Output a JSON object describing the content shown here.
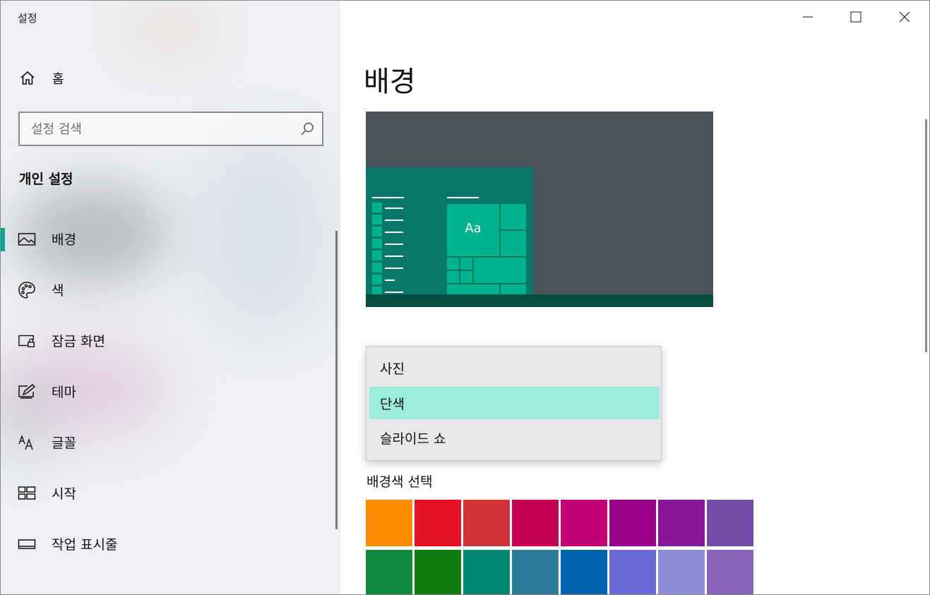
{
  "window": {
    "title": "설정"
  },
  "sidebar": {
    "home_label": "홈",
    "search_placeholder": "설정 검색",
    "section_title": "개인 설정",
    "items": [
      {
        "label": "배경",
        "icon": "picture-icon",
        "selected": true
      },
      {
        "label": "색",
        "icon": "palette-icon",
        "selected": false
      },
      {
        "label": "잠금 화면",
        "icon": "lock-screen-icon",
        "selected": false
      },
      {
        "label": "테마",
        "icon": "theme-brush-icon",
        "selected": false
      },
      {
        "label": "글꼴",
        "icon": "font-icon",
        "selected": false
      },
      {
        "label": "시작",
        "icon": "start-tiles-icon",
        "selected": false
      },
      {
        "label": "작업 표시줄",
        "icon": "taskbar-icon",
        "selected": false
      }
    ]
  },
  "main": {
    "page_title": "배경",
    "preview": {
      "tile_text": "Aa",
      "colors": {
        "desktop": "#4b535c",
        "start": "#0a7868",
        "tile": "#00b38f",
        "taskbar": "#064e42"
      }
    },
    "background_dropdown": {
      "options": [
        "사진",
        "단색",
        "슬라이드 쇼"
      ],
      "selected": "단색"
    },
    "bg_color_label": "배경색 선택",
    "swatches": [
      "#ff8c00",
      "#e81123",
      "#d13438",
      "#c30052",
      "#bf0077",
      "#9a0089",
      "#881798",
      "#744da9",
      "#10893e",
      "#107c10",
      "#018574",
      "#2d7d9a",
      "#0063b1",
      "#6b69d6",
      "#8e8cd8",
      "#8764b8"
    ]
  },
  "accent_color": "#00a98f"
}
